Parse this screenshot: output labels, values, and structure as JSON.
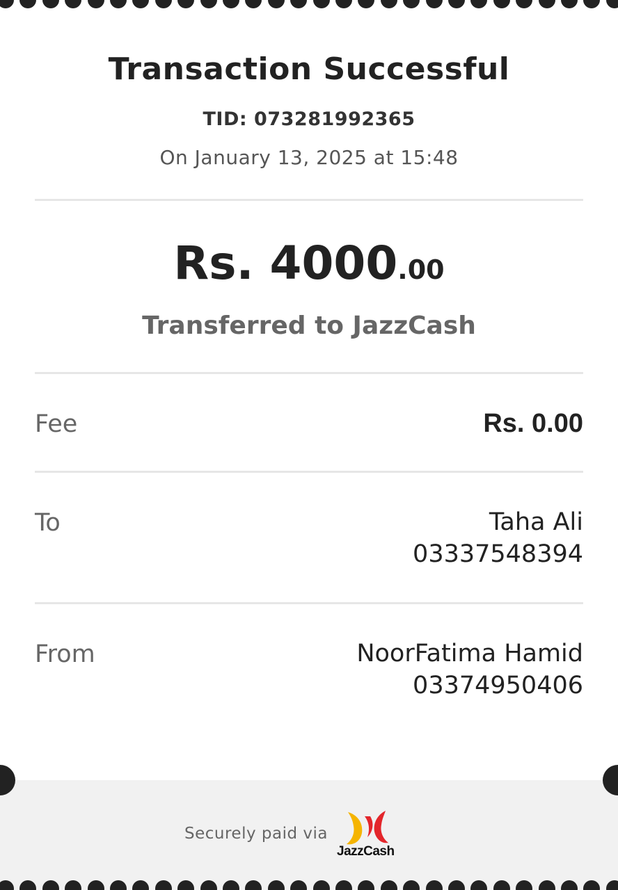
{
  "receipt": {
    "title": "Transaction Successful",
    "tid": "TID: 073281992365",
    "date": "On January 13, 2025 at 15:48",
    "amount_main": "Rs. 4000",
    "amount_cents": ".00",
    "subtitle": "Transferred to JazzCash",
    "rows": [
      {
        "label": "Fee",
        "value": "Rs. 0.00"
      },
      {
        "label": "To",
        "name": "Taha Ali",
        "number": "03337548394"
      },
      {
        "label": "From",
        "name": "NoorFatima Hamid",
        "number": "03374950406"
      }
    ]
  },
  "footer": {
    "text": "Securely paid via",
    "logo_text": "JazzCash",
    "logo_icon": "jazzcash-logo-icon"
  },
  "colors": {
    "text_dark": "#222222",
    "text_muted": "#666666",
    "divider": "#e6e6e6",
    "footer_bg": "#f1f1f1",
    "logo_yellow": "#f5b400",
    "logo_red": "#e3262b"
  }
}
